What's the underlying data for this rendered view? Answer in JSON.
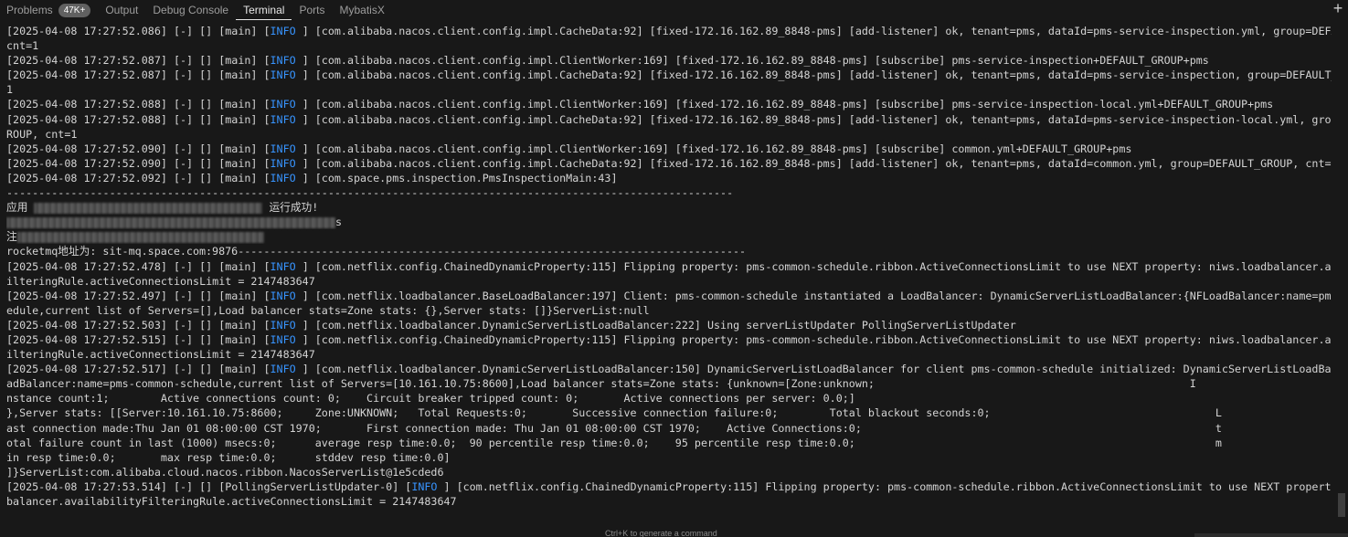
{
  "tabs": [
    {
      "label": "Problems",
      "badge": "47K+"
    },
    {
      "label": "Output"
    },
    {
      "label": "Debug Console"
    },
    {
      "label": "Terminal",
      "active": true
    },
    {
      "label": "Ports"
    },
    {
      "label": "MybatisX"
    }
  ],
  "new_terminal_icon": "plus-icon",
  "colors": {
    "info": "#3794ff",
    "background": "#181818",
    "text": "#d4d4d4"
  },
  "terminal": {
    "lines": [
      {
        "pre": "[2025-04-08 17:27:52.086] [-] [] [main] [",
        "info": "INFO ",
        "post": "] [com.alibaba.nacos.client.config.impl.CacheData:92] [fixed-172.16.162.89_8848-pms] [add-listener] ok, tenant=pms, dataId=pms-service-inspection.yml, group=DEFAULT_GROUP,"
      },
      {
        "pre": "cnt=1"
      },
      {
        "pre": "[2025-04-08 17:27:52.087] [-] [] [main] [",
        "info": "INFO ",
        "post": "] [com.alibaba.nacos.client.config.impl.ClientWorker:169] [fixed-172.16.162.89_8848-pms] [subscribe] pms-service-inspection+DEFAULT_GROUP+pms"
      },
      {
        "pre": "[2025-04-08 17:27:52.087] [-] [] [main] [",
        "info": "INFO ",
        "post": "] [com.alibaba.nacos.client.config.impl.CacheData:92] [fixed-172.16.162.89_8848-pms] [add-listener] ok, tenant=pms, dataId=pms-service-inspection, group=DEFAULT_GROUP, cnt="
      },
      {
        "pre": "1"
      },
      {
        "pre": "[2025-04-08 17:27:52.088] [-] [] [main] [",
        "info": "INFO ",
        "post": "] [com.alibaba.nacos.client.config.impl.ClientWorker:169] [fixed-172.16.162.89_8848-pms] [subscribe] pms-service-inspection-local.yml+DEFAULT_GROUP+pms"
      },
      {
        "pre": "[2025-04-08 17:27:52.088] [-] [] [main] [",
        "info": "INFO ",
        "post": "] [com.alibaba.nacos.client.config.impl.CacheData:92] [fixed-172.16.162.89_8848-pms] [add-listener] ok, tenant=pms, dataId=pms-service-inspection-local.yml, group=DEFAULT_G"
      },
      {
        "pre": "ROUP, cnt=1"
      },
      {
        "pre": "[2025-04-08 17:27:52.090] [-] [] [main] [",
        "info": "INFO ",
        "post": "] [com.alibaba.nacos.client.config.impl.ClientWorker:169] [fixed-172.16.162.89_8848-pms] [subscribe] common.yml+DEFAULT_GROUP+pms"
      },
      {
        "pre": "[2025-04-08 17:27:52.090] [-] [] [main] [",
        "info": "INFO ",
        "post": "] [com.alibaba.nacos.client.config.impl.CacheData:92] [fixed-172.16.162.89_8848-pms] [add-listener] ok, tenant=pms, dataId=common.yml, group=DEFAULT_GROUP, cnt=1"
      },
      {
        "pre": "[2025-04-08 17:27:52.092] [-] [] [main] [",
        "info": "INFO ",
        "post": "] [com.space.pms.inspection.PmsInspectionMain:43]"
      },
      {
        "pre": "-----------------------------------------------------------------------------------------------------------------"
      },
      {
        "pre": "应用 ",
        "redact": 250,
        "post": " 运行成功!"
      },
      {
        "pre": "",
        "redact": 360,
        "post": "s"
      },
      {
        "pre": "注",
        "redact": 270
      },
      {
        "pre": "rocketmq地址为: sit-mq.space.com:9876-------------------------------------------------------------------------------"
      },
      {
        "pre": "[2025-04-08 17:27:52.478] [-] [] [main] [",
        "info": "INFO ",
        "post": "] [com.netflix.config.ChainedDynamicProperty:115] Flipping property: pms-common-schedule.ribbon.ActiveConnectionsLimit to use NEXT property: niws.loadbalancer.availabilityF"
      },
      {
        "pre": "ilteringRule.activeConnectionsLimit = 2147483647"
      },
      {
        "pre": "[2025-04-08 17:27:52.497] [-] [] [main] [",
        "info": "INFO ",
        "post": "] [com.netflix.loadbalancer.BaseLoadBalancer:197] Client: pms-common-schedule instantiated a LoadBalancer: DynamicServerListLoadBalancer:{NFLoadBalancer:name=pms-common-sch"
      },
      {
        "pre": "edule,current list of Servers=[],Load balancer stats=Zone stats: {},Server stats: []}ServerList:null"
      },
      {
        "pre": "[2025-04-08 17:27:52.503] [-] [] [main] [",
        "info": "INFO ",
        "post": "] [com.netflix.loadbalancer.DynamicServerListLoadBalancer:222] Using serverListUpdater PollingServerListUpdater"
      },
      {
        "pre": "[2025-04-08 17:27:52.515] [-] [] [main] [",
        "info": "INFO ",
        "post": "] [com.netflix.config.ChainedDynamicProperty:115] Flipping property: pms-common-schedule.ribbon.ActiveConnectionsLimit to use NEXT property: niws.loadbalancer.availabilityF"
      },
      {
        "pre": "ilteringRule.activeConnectionsLimit = 2147483647"
      },
      {
        "pre": "[2025-04-08 17:27:52.517] [-] [] [main] [",
        "info": "INFO ",
        "post": "] [com.netflix.loadbalancer.DynamicServerListLoadBalancer:150] DynamicServerListLoadBalancer for client pms-common-schedule initialized: DynamicServerListLoadBalancer:{NFLo"
      },
      {
        "pre": "adBalancer:name=pms-common-schedule,current list of Servers=[10.161.10.75:8600],Load balancer stats=Zone stats: {unknown=[Zone:unknown;                                                 I"
      },
      {
        "pre": "nstance count:1;        Active connections count: 0;    Circuit breaker tripped count: 0;       Active connections per server: 0.0;]"
      },
      {
        "pre": "},Server stats: [[Server:10.161.10.75:8600;     Zone:UNKNOWN;   Total Requests:0;       Successive connection failure:0;        Total blackout seconds:0;                                   L"
      },
      {
        "pre": "ast connection made:Thu Jan 01 08:00:00 CST 1970;       First connection made: Thu Jan 01 08:00:00 CST 1970;    Active Connections:0;                                                       t"
      },
      {
        "pre": "otal failure count in last (1000) msecs:0;      average resp time:0.0;  90 percentile resp time:0.0;    95 percentile resp time:0.0;                                                        m"
      },
      {
        "pre": "in resp time:0.0;       max resp time:0.0;      stddev resp time:0.0]"
      },
      {
        "pre": "]}ServerList:com.alibaba.cloud.nacos.ribbon.NacosServerList@1e5cded6"
      },
      {
        "pre": "[2025-04-08 17:27:53.514] [-] [] [PollingServerListUpdater-0] [",
        "info": "INFO ",
        "post": "] [com.netflix.config.ChainedDynamicProperty:115] Flipping property: pms-common-schedule.ribbon.ActiveConnectionsLimit to use NEXT property: niws.load"
      },
      {
        "pre": "balancer.availabilityFilteringRule.activeConnectionsLimit = 2147483647"
      }
    ]
  },
  "hint": "Ctrl+K to generate a command"
}
